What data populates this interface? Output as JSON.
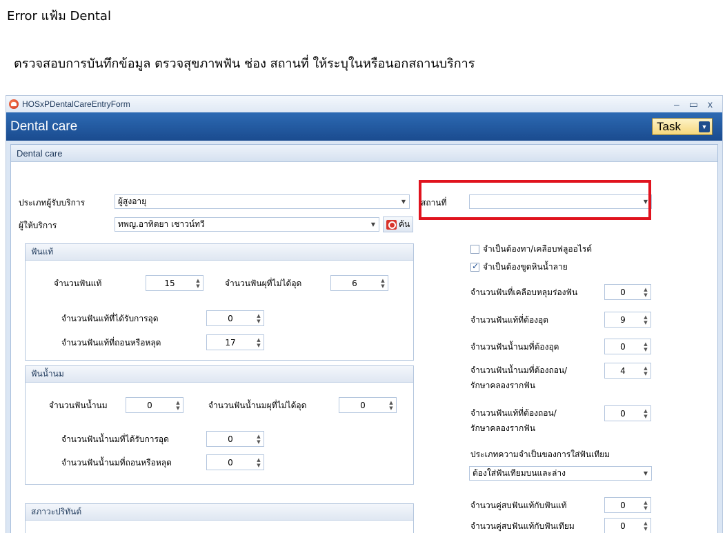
{
  "doc": {
    "title": "Error แฟ้ม Dental",
    "description": "ตรวจสอบการบันทึกข้อมูล ตรวจสุขภาพฟัน ช่อง สถานที่ ให้ระบุในหรือนอกสถานบริการ"
  },
  "window": {
    "title": "HOSxPDentalCareEntryForm",
    "controls": {
      "minimize": "–",
      "maximize": "▭",
      "close": "x"
    }
  },
  "header": {
    "title": "Dental care",
    "task_label": "Task"
  },
  "panel": {
    "title": "Dental care"
  },
  "form": {
    "service_type_label": "ประเภทผู้รับบริการ",
    "service_type_value": "ผู้สูงอายุ",
    "place_label": "สถานที่",
    "place_value": "",
    "provider_label": "ผู้ให้บริการ",
    "provider_value": "ทพญ.อาทิตยา เชาวน์ทวี",
    "find_label": "ค้น"
  },
  "permanent": {
    "title": "ฟันแท้",
    "total_label": "จำนวนฟันแท้",
    "total_value": "15",
    "unfilled_decay_label": "จำนวนฟันผุที่ไม่ได้อุด",
    "unfilled_decay_value": "6",
    "filled_label": "จำนวนฟันแท้ที่ได้รับการอุด",
    "filled_value": "0",
    "extracted_label": "จำนวนฟันแท้ที่ถอนหรือหลุด",
    "extracted_value": "17"
  },
  "primary": {
    "title": "ฟันน้ำนม",
    "total_label": "จำนวนฟันน้ำนม",
    "total_value": "0",
    "unfilled_decay_label": "จำนวนฟันน้ำนมผุที่ไม่ได้อุด",
    "unfilled_decay_value": "0",
    "filled_label": "จำนวนฟันน้ำนมที่ได้รับการอุด",
    "filled_value": "0",
    "extracted_label": "จำนวนฟันน้ำนมที่ถอนหรือหลุด",
    "extracted_value": "0"
  },
  "periodontal": {
    "title": "สภาวะปริทันต์"
  },
  "right": {
    "fluoride_label": "จำเป็นต้องทา/เคลือบฟลูออไรด์",
    "fluoride_checked": false,
    "scaling_label": "จำเป็นต้องขูดหินน้ำลาย",
    "scaling_checked": true,
    "sealant_label": "จำนวนฟันที่เคลือบหลุมร่องฟัน",
    "sealant_value": "0",
    "perm_need_fill_label": "จำนวนฟันแท้ที่ต้องอุด",
    "perm_need_fill_value": "9",
    "prim_need_fill_label": "จำนวนฟันน้ำนมที่ต้องอุด",
    "prim_need_fill_value": "0",
    "prim_need_extract_label_1": "จำนวนฟันน้ำนมที่ต้องถอน/",
    "prim_need_extract_label_2": "รักษาคลองรากฟัน",
    "prim_need_extract_value": "4",
    "perm_need_extract_label_1": "จำนวนฟันแท้ที่ต้องถอน/",
    "perm_need_extract_label_2": "รักษาคลองรากฟัน",
    "perm_need_extract_value": "0",
    "denture_need_label": "ประเภทความจำเป็นของการใส่ฟันเทียม",
    "denture_need_value": "ต้องใส่ฟันเทียมบนและล่าง",
    "occlusion_natural_label": "จำนวนคู่สบฟันแท้กับฟันแท้",
    "occlusion_natural_value": "0",
    "occlusion_denture_label": "จำนวนคู่สบฟันแท้กับฟันเทียม",
    "occlusion_denture_value": "0"
  }
}
